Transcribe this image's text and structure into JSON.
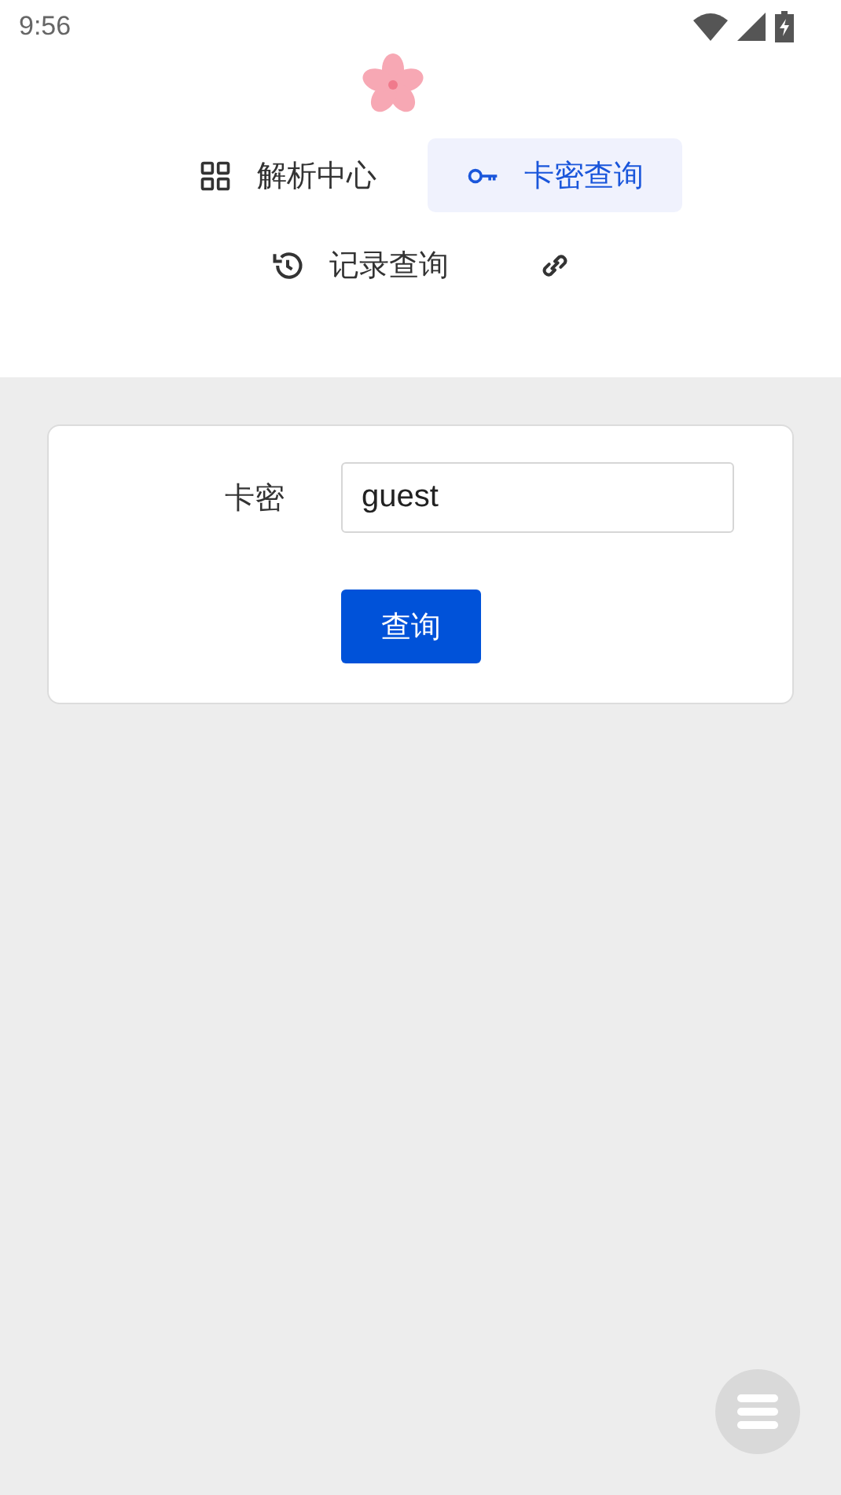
{
  "status_bar": {
    "time": "9:56"
  },
  "nav": [
    {
      "label": "解析中心",
      "selected": false
    },
    {
      "label": "卡密查询",
      "selected": true
    },
    {
      "label": "记录查询",
      "selected": false
    },
    {
      "selected": false
    }
  ],
  "form": {
    "label": "卡密",
    "value": "guest",
    "button": "查询"
  }
}
